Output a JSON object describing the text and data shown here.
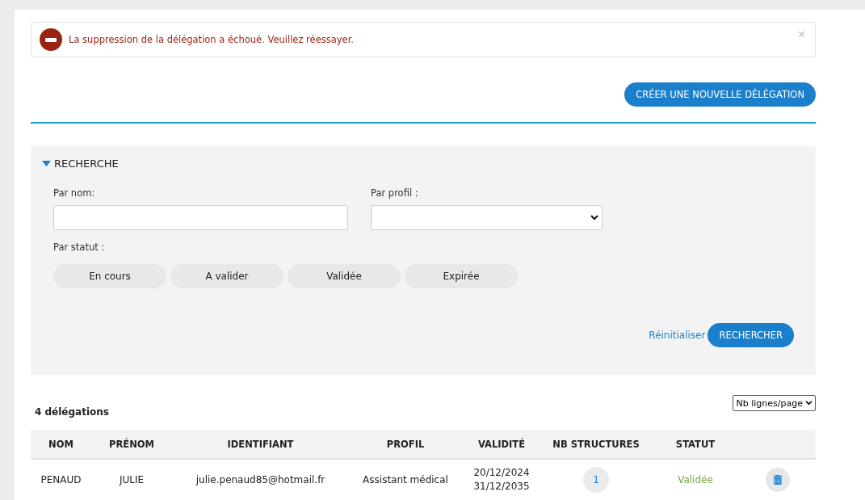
{
  "alert": {
    "message": "La suppression de la délégation a échoué. Veuillez réessayer.",
    "close": "×"
  },
  "create_button": "CRÉER UNE NOUVELLE DÉLÉGATION",
  "search": {
    "title": "RECHERCHE",
    "expanded": true,
    "name_label": "Par nom:",
    "profile_label": "Par profil :",
    "status_label": "Par statut :",
    "statuses": [
      {
        "label": "En cours",
        "selected": false
      },
      {
        "label": "A valider",
        "selected": false
      },
      {
        "label": "Validée",
        "selected": false
      },
      {
        "label": "Expirée",
        "selected": false
      }
    ],
    "reset": "Réinitialiser",
    "submit": "RECHERCHER"
  },
  "count": "4 délégations",
  "page_size": "Nb lignes/page",
  "table": {
    "columns": [
      "NOM",
      "PRÉNOM",
      "IDENTIFIANT",
      "PROFIL",
      "VALIDITÉ",
      "NB STRUCTURES",
      "STATUT"
    ],
    "rows": [
      {
        "nom": "PENAUD",
        "prenom": "JULIE",
        "identifiant": "julie.penaud85@hotmail.fr",
        "profil": "Assistant médical",
        "validite": [
          "20/12/2024",
          "31/12/2035"
        ],
        "structures": "1",
        "statut": "Validée",
        "color": "#7aa33d"
      }
    ]
  }
}
